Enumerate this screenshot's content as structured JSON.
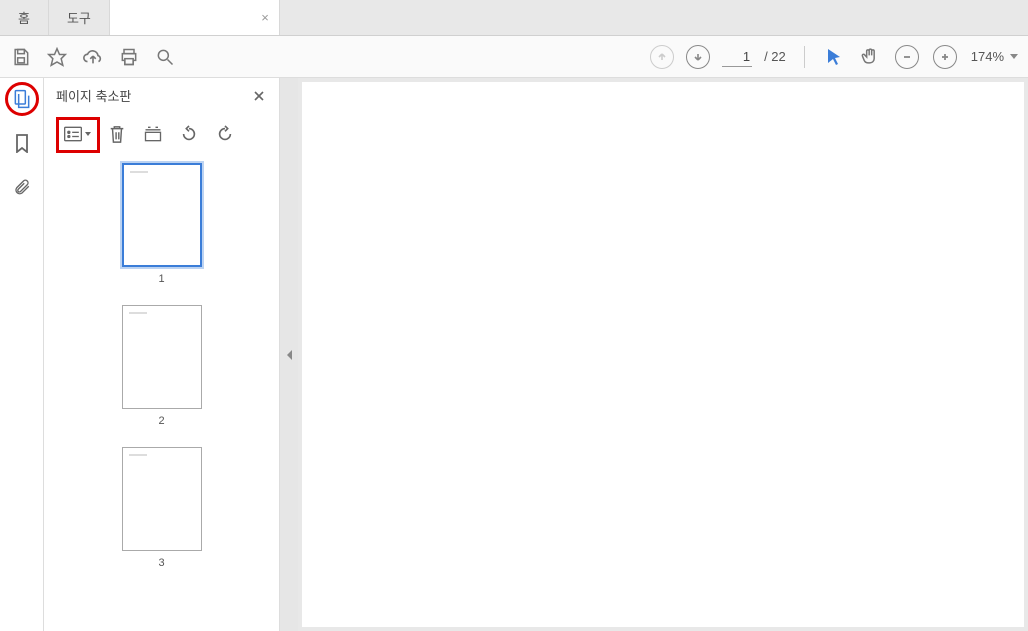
{
  "tabs": {
    "home": "홈",
    "tools": "도구",
    "document": ""
  },
  "toolbar": {
    "page_current": "1",
    "page_total": "/ 22",
    "zoom": "174%"
  },
  "panel": {
    "title": "페이지 축소판"
  },
  "thumbs": [
    {
      "num": "1",
      "selected": true
    },
    {
      "num": "2",
      "selected": false
    },
    {
      "num": "3",
      "selected": false
    }
  ]
}
